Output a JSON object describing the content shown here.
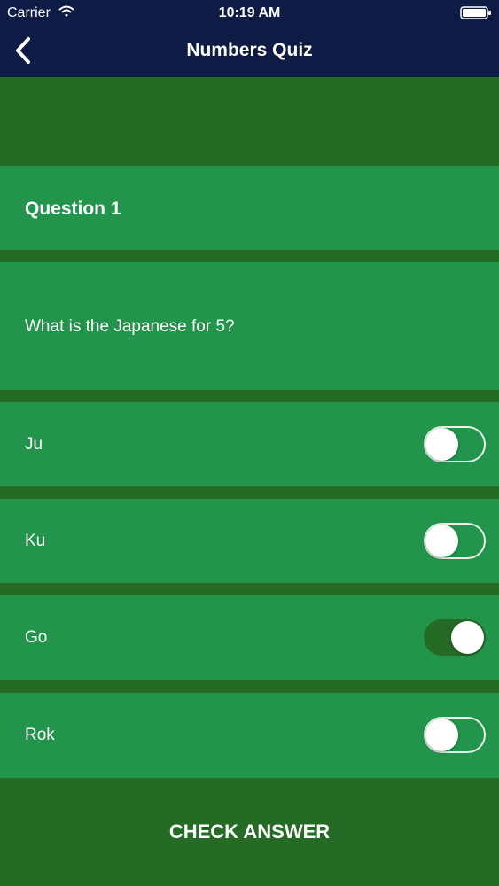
{
  "status_bar": {
    "carrier": "Carrier",
    "time": "10:19 AM",
    "icons": [
      "wifi-icon",
      "battery-icon"
    ]
  },
  "nav": {
    "title": "Numbers Quiz",
    "back_icon": "chevron-left-icon"
  },
  "question": {
    "label": "Question 1",
    "text": "What is the Japanese for 5?"
  },
  "answers": [
    {
      "label": "Ju",
      "selected": false
    },
    {
      "label": "Ku",
      "selected": false
    },
    {
      "label": "Go",
      "selected": true
    },
    {
      "label": "Rok",
      "selected": false
    }
  ],
  "check_button": {
    "label": "CHECK ANSWER"
  },
  "colors": {
    "header": "#0d1b45",
    "background": "#256b26",
    "card": "#22944b",
    "switch_on": "#256b26",
    "text": "#ffffff"
  }
}
